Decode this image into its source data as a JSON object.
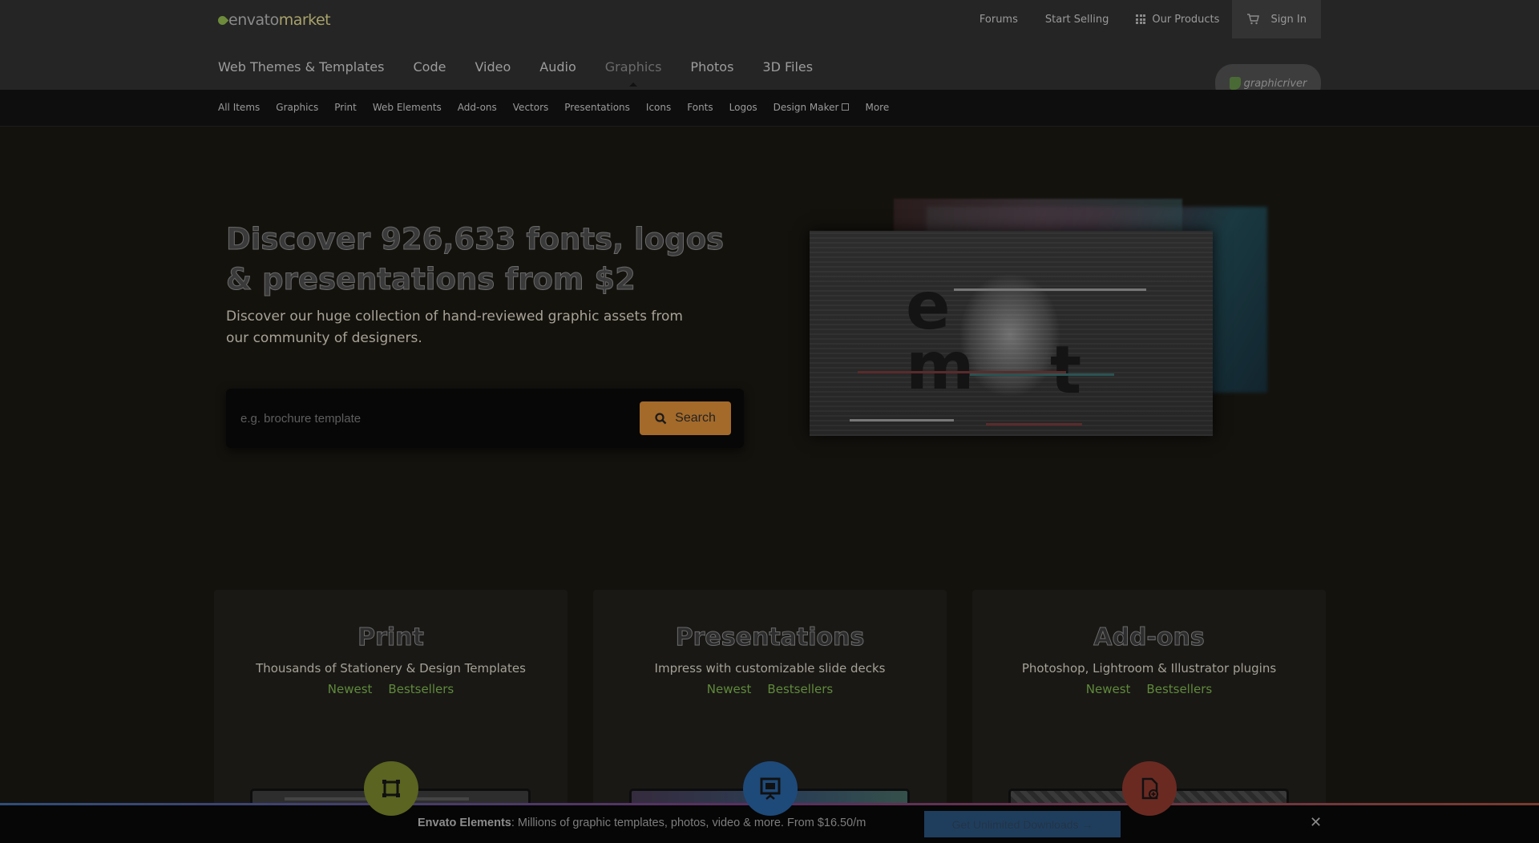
{
  "header": {
    "logo_envato": "envato",
    "logo_market": "market",
    "links": {
      "forums": "Forums",
      "start_selling": "Start Selling",
      "our_products": "Our Products",
      "sign_in": "Sign In"
    },
    "main_nav": [
      "Web Themes & Templates",
      "Code",
      "Video",
      "Audio",
      "Graphics",
      "Photos",
      "3D Files"
    ],
    "active_nav": "Graphics",
    "site_badge": "graphicriver"
  },
  "subnav": {
    "items": [
      "All Items",
      "Graphics",
      "Print",
      "Web Elements",
      "Add-ons",
      "Vectors",
      "Presentations",
      "Icons",
      "Fonts",
      "Logos",
      "Design Maker",
      "More"
    ]
  },
  "hero": {
    "title": "Discover 926,633 fonts, logos & presentations from $2",
    "subtitle": "Discover our huge collection of hand-reviewed graphic assets from our community of designers.",
    "search_placeholder": "e.g. brochure template",
    "search_button": "Search"
  },
  "cards": [
    {
      "title": "Print",
      "description": "Thousands of Stationery & Design Templates",
      "link_newest": "Newest",
      "link_bestsellers": "Bestsellers",
      "icon": "print-icon",
      "icon_color": "#5b6420"
    },
    {
      "title": "Presentations",
      "description": "Impress with customizable slide decks",
      "link_newest": "Newest",
      "link_bestsellers": "Bestsellers",
      "icon": "presentation-icon",
      "icon_color": "#1e4a7a"
    },
    {
      "title": "Add-ons",
      "description": "Photoshop, Lightroom & Illustrator plugins",
      "link_newest": "Newest",
      "link_bestsellers": "Bestsellers",
      "icon": "plugin-icon",
      "icon_color": "#6a2a22"
    }
  ],
  "banner": {
    "brand": "Envato Elements",
    "text": ": Millions of graphic templates, photos, video & more. From $16.50/m",
    "cta": "Get Unlimited Downloads →",
    "close": "✕"
  },
  "colors": {
    "accent_button": "#a46a2a",
    "link_green": "#5f8a3a",
    "cta_blue": "#1f3e5e"
  }
}
